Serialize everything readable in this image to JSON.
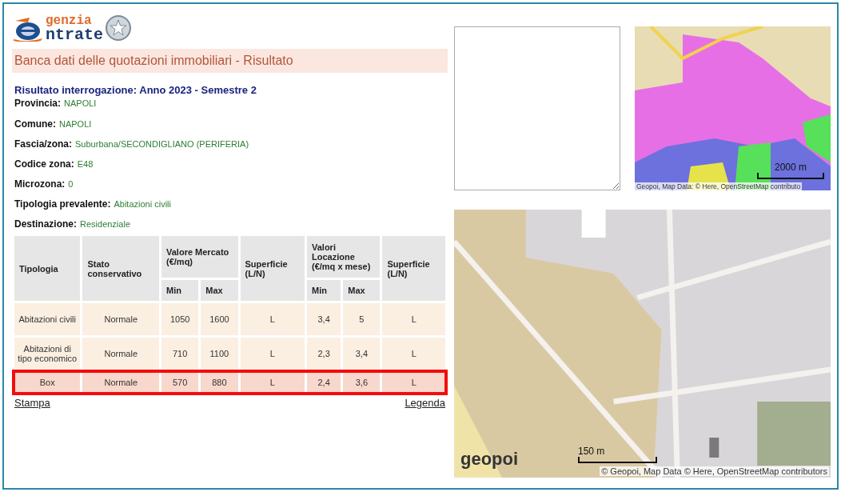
{
  "logo": {
    "line_1": "genzia",
    "line_2": "ntrate"
  },
  "page_title": "Banca dati delle quotazioni immobiliari - Risultato",
  "result_title": "Risultato interrogazione: Anno 2023 - Semestre 2",
  "fields": [
    {
      "label": "Provincia:",
      "value": "NAPOLI"
    },
    {
      "label": "Comune:",
      "value": "NAPOLI"
    },
    {
      "label": "Fascia/zona:",
      "value": "Suburbana/SECONDIGLIANO (PERIFERIA)"
    },
    {
      "label": "Codice zona:",
      "value": "E48"
    },
    {
      "label": "Microzona:",
      "value": "0"
    },
    {
      "label": "Tipologia prevalente:",
      "value": "Abitazioni civili"
    },
    {
      "label": "Destinazione:",
      "value": "Residenziale"
    }
  ],
  "table": {
    "columns": [
      {
        "label": "Tipologia"
      },
      {
        "label": "Stato conservativo"
      },
      {
        "label": "Valore Mercato (€/mq)",
        "colspan": 2,
        "sub": [
          "Min",
          "Max"
        ]
      },
      {
        "label": "Superficie (L/N)"
      },
      {
        "label": "Valori Locazione (€/mq x mese)",
        "colspan": 2,
        "sub": [
          "Min",
          "Max"
        ]
      },
      {
        "label": "Superficie (L/N)"
      }
    ],
    "rows": [
      {
        "selected": false,
        "cells": [
          "Abitazioni civili",
          "Normale",
          "1050",
          "1600",
          "L",
          "3,4",
          "5",
          "L"
        ]
      },
      {
        "selected": false,
        "cells": [
          "Abitazioni di tipo economico",
          "Normale",
          "710",
          "1100",
          "L",
          "2,3",
          "3,4",
          "L"
        ]
      },
      {
        "selected": true,
        "cells": [
          "Box",
          "Normale",
          "570",
          "880",
          "L",
          "2,4",
          "3,6",
          "L"
        ]
      }
    ]
  },
  "links": {
    "print": "Stampa",
    "legend": "Legenda"
  },
  "small_map": {
    "scale": "2000 m",
    "attribution": "Geopoi, Map Data: © Here, OpenStreetMap contributo"
  },
  "large_map": {
    "logo": "geopoi",
    "scale": "150 m",
    "attribution": "© Geopoi, Map Data © Here, OpenStreetMap contributors"
  }
}
